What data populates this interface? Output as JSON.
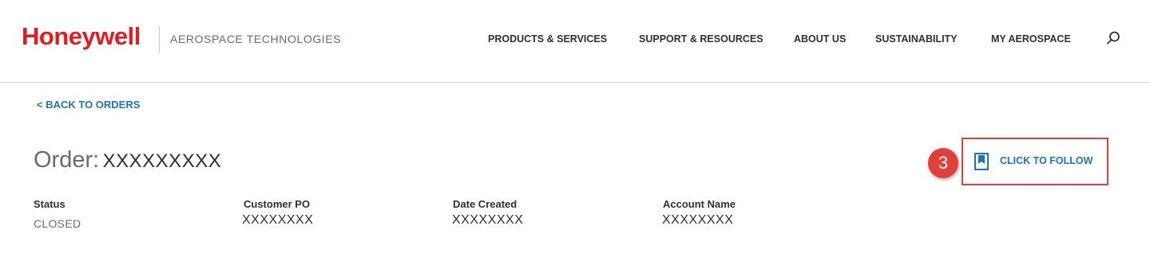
{
  "header": {
    "logo": "Honeywell",
    "tagline": "AEROSPACE TECHNOLOGIES",
    "nav": [
      {
        "label": "PRODUCTS & SERVICES"
      },
      {
        "label": "SUPPORT & RESOURCES"
      },
      {
        "label": "ABOUT US"
      },
      {
        "label": "SUSTAINABILITY"
      },
      {
        "label": "MY AEROSPACE"
      }
    ],
    "search_icon": "search-icon"
  },
  "back_link": "< BACK TO ORDERS",
  "order": {
    "label": "Order:",
    "number": "XXXXXXXXX",
    "fields": [
      {
        "label": "Status",
        "value": "CLOSED"
      },
      {
        "label": "Customer PO",
        "value": "XXXXXXXX"
      },
      {
        "label": "Date Created",
        "value": "XXXXXXXX"
      },
      {
        "label": "Account Name",
        "value": "XXXXXXXX"
      }
    ]
  },
  "follow": {
    "label": "CLICK TO FOLLOW",
    "icon": "bookmark-icon"
  },
  "callout": {
    "number": "3"
  },
  "colors": {
    "brand_red": "#e31b23",
    "link_blue": "#1c75bc",
    "callout_red": "#e0403a"
  }
}
